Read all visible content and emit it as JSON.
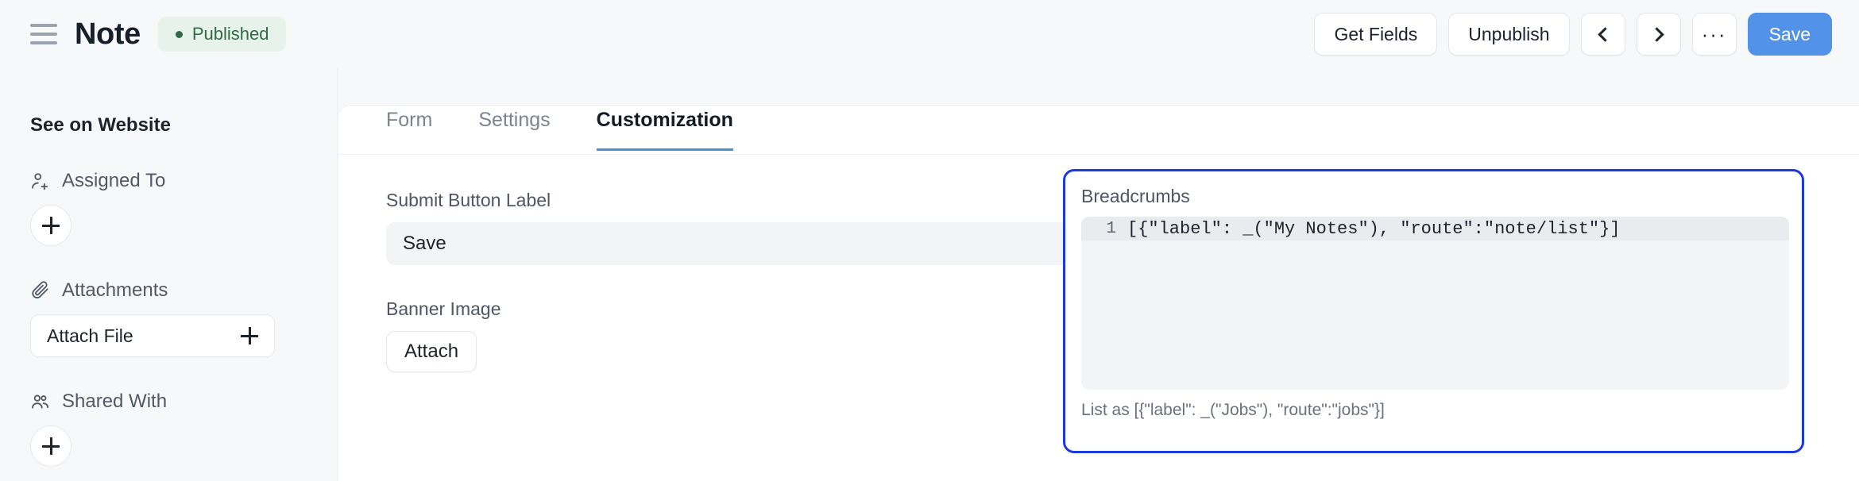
{
  "header": {
    "menu_icon": "hamburger-icon",
    "title": "Note",
    "status": {
      "label": "Published",
      "dot_color": "#2f6b44",
      "bg_color": "#e7f3ea"
    },
    "actions": {
      "get_fields": "Get Fields",
      "unpublish": "Unpublish",
      "prev_icon": "chevron-left-icon",
      "next_icon": "chevron-right-icon",
      "more_icon": "ellipsis-icon",
      "more_label": "···",
      "save": "Save",
      "save_color": "#5292e8"
    }
  },
  "sidebar": {
    "see_on_website": "See on Website",
    "sections": [
      {
        "icon": "user-plus-icon",
        "label": "Assigned To",
        "add_label": "+"
      },
      {
        "icon": "paperclip-icon",
        "label": "Attachments",
        "button_label": "Attach File",
        "add_label": "+"
      },
      {
        "icon": "users-icon",
        "label": "Shared With",
        "add_label": "+"
      }
    ]
  },
  "main": {
    "tabs": [
      {
        "label": "Form",
        "active": false
      },
      {
        "label": "Settings",
        "active": false
      },
      {
        "label": "Customization",
        "active": true
      }
    ],
    "active_tab_underline_color": "#4b8fd8",
    "fields": {
      "submit_button": {
        "label": "Submit Button Label",
        "value": "Save",
        "placeholder": ""
      },
      "banner_image": {
        "label": "Banner Image",
        "button_label": "Attach"
      }
    },
    "breadcrumbs_field": {
      "label": "Breadcrumbs",
      "focus_color": "#1a3ae0",
      "line_number": "1",
      "code": "[{\"label\": _(\"My Notes\"), \"route\":\"note/list\"}]",
      "help_text": "List as [{\"label\": _(\"Jobs\"), \"route\":\"jobs\"}]"
    }
  }
}
